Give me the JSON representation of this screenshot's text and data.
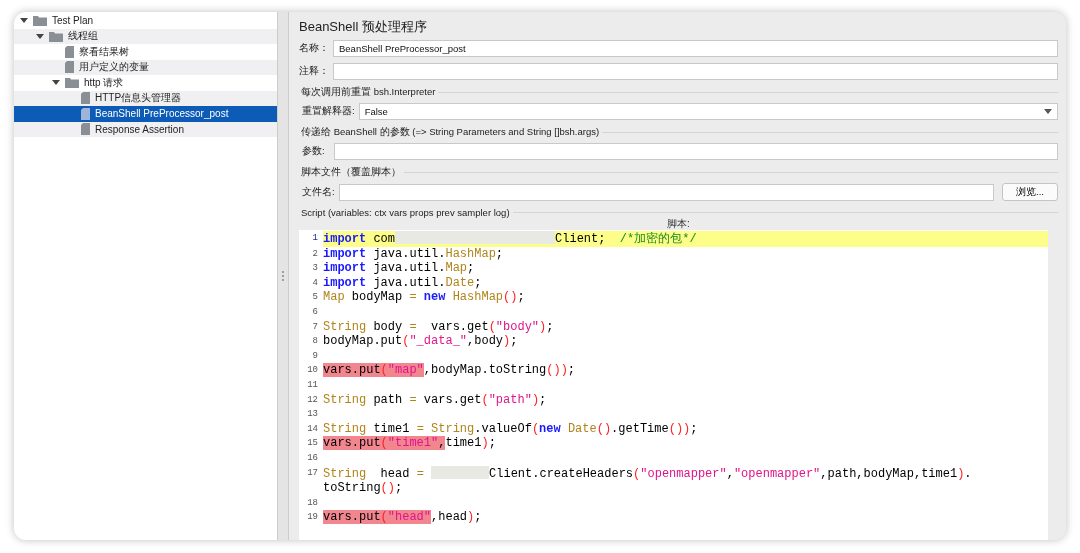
{
  "tree": [
    {
      "label": "Test Plan",
      "expanded": true,
      "selected": false,
      "children": [
        {
          "label": "线程组",
          "expanded": true,
          "selected": false,
          "children": [
            {
              "label": "察看结果树",
              "selected": false
            },
            {
              "label": "用户定义的变量",
              "selected": false
            },
            {
              "label": "http 请求",
              "expanded": true,
              "selected": false,
              "children": [
                {
                  "label": "HTTP信息头管理器",
                  "selected": false
                },
                {
                  "label": "BeanShell PreProcessor_post",
                  "selected": true
                },
                {
                  "label": "Response Assertion",
                  "selected": false
                }
              ]
            }
          ]
        }
      ]
    }
  ],
  "panel": {
    "title": "BeanShell 预处理程序",
    "name_field": {
      "label": "名称：",
      "value": "BeanShell PreProcessor_post"
    },
    "comment_field": {
      "label": "注释："
    },
    "reset_section": {
      "title": "每次调用前重置 bsh.Interpreter",
      "label": "重置解释器:",
      "value": "False"
    },
    "params_section": {
      "title": "传递给 BeanShell 的参数 (=> String Parameters and String []bsh.args)",
      "label": "参数:"
    },
    "file_section": {
      "title": "脚本文件（覆盖脚本）",
      "label": "文件名:",
      "button": "浏览..."
    },
    "script_section": {
      "title": "Script (variables: ctx vars props prev sampler log)",
      "editor_label": "脚本:",
      "lines": [
        {
          "number": "1",
          "current": true,
          "tokens": [
            {
              "kind": "keyword",
              "text": "import"
            },
            {
              "kind": "plain",
              "text": " com"
            },
            {
              "kind": "redacted_long"
            },
            {
              "kind": "plain",
              "text": "Client;  "
            },
            {
              "kind": "comment",
              "text": "/*加密的包*/"
            }
          ]
        },
        {
          "number": "2",
          "current": false,
          "tokens": [
            {
              "kind": "keyword",
              "text": "import"
            },
            {
              "kind": "plain",
              "text": " java.util."
            },
            {
              "kind": "type",
              "text": "HashMap"
            },
            {
              "kind": "plain",
              "text": ";"
            }
          ]
        },
        {
          "number": "3",
          "current": false,
          "tokens": [
            {
              "kind": "keyword",
              "text": "import"
            },
            {
              "kind": "plain",
              "text": " java.util."
            },
            {
              "kind": "type",
              "text": "Map"
            },
            {
              "kind": "plain",
              "text": ";"
            }
          ]
        },
        {
          "number": "4",
          "current": false,
          "tokens": [
            {
              "kind": "keyword",
              "text": "import"
            },
            {
              "kind": "plain",
              "text": " java.util."
            },
            {
              "kind": "type",
              "text": "Date"
            },
            {
              "kind": "plain",
              "text": ";"
            }
          ]
        },
        {
          "number": "5",
          "current": false,
          "tokens": [
            {
              "kind": "type",
              "text": "Map"
            },
            {
              "kind": "plain",
              "text": " bodyMap "
            },
            {
              "kind": "operator",
              "text": "="
            },
            {
              "kind": "keyword",
              "text": " new"
            },
            {
              "kind": "type",
              "text": " HashMap"
            },
            {
              "kind": "paren",
              "text": "()"
            },
            {
              "kind": "plain",
              "text": ";"
            }
          ]
        },
        {
          "number": "6",
          "current": false
        },
        {
          "number": "7",
          "current": false,
          "tokens": [
            {
              "kind": "type",
              "text": "String"
            },
            {
              "kind": "plain",
              "text": " body "
            },
            {
              "kind": "operator",
              "text": "="
            },
            {
              "kind": "plain",
              "text": "  vars.get"
            },
            {
              "kind": "paren",
              "text": "("
            },
            {
              "kind": "string",
              "text": "\"body\""
            },
            {
              "kind": "paren",
              "text": ")"
            },
            {
              "kind": "plain",
              "text": ";"
            }
          ]
        },
        {
          "number": "8",
          "current": false,
          "tokens": [
            {
              "kind": "plain",
              "text": "bodyMap.put"
            },
            {
              "kind": "paren",
              "text": "("
            },
            {
              "kind": "string",
              "text": "\"_data_\""
            },
            {
              "kind": "plain",
              "text": ",body"
            },
            {
              "kind": "paren",
              "text": ")"
            },
            {
              "kind": "plain",
              "text": ";"
            }
          ]
        },
        {
          "number": "9",
          "current": false
        },
        {
          "number": "10",
          "current": false,
          "tokens": [
            {
              "kind": "plain",
              "text": "vars.put",
              "marked": true
            },
            {
              "kind": "paren",
              "text": "(",
              "marked": true
            },
            {
              "kind": "string",
              "text": "\"map\"",
              "marked": true
            },
            {
              "kind": "plain",
              "text": ",bodyMap.toString"
            },
            {
              "kind": "paren",
              "text": "())"
            },
            {
              "kind": "plain",
              "text": ";"
            }
          ]
        },
        {
          "number": "11",
          "current": false
        },
        {
          "number": "12",
          "current": false,
          "tokens": [
            {
              "kind": "type",
              "text": "String"
            },
            {
              "kind": "plain",
              "text": " path "
            },
            {
              "kind": "operator",
              "text": "="
            },
            {
              "kind": "plain",
              "text": " vars.get"
            },
            {
              "kind": "paren",
              "text": "("
            },
            {
              "kind": "string",
              "text": "\"path\""
            },
            {
              "kind": "paren",
              "text": ")"
            },
            {
              "kind": "plain",
              "text": ";"
            }
          ]
        },
        {
          "number": "13",
          "current": false
        },
        {
          "number": "14",
          "current": false,
          "tokens": [
            {
              "kind": "type",
              "text": "String"
            },
            {
              "kind": "plain",
              "text": " time1 "
            },
            {
              "kind": "operator",
              "text": "="
            },
            {
              "kind": "type",
              "text": " String"
            },
            {
              "kind": "plain",
              "text": ".valueOf"
            },
            {
              "kind": "paren",
              "text": "("
            },
            {
              "kind": "keyword",
              "text": "new"
            },
            {
              "kind": "type",
              "text": " Date"
            },
            {
              "kind": "paren",
              "text": "()"
            },
            {
              "kind": "plain",
              "text": ".getTime"
            },
            {
              "kind": "paren",
              "text": "())"
            },
            {
              "kind": "plain",
              "text": ";"
            }
          ]
        },
        {
          "number": "15",
          "current": false,
          "tokens": [
            {
              "kind": "plain",
              "text": "vars.put",
              "marked": true
            },
            {
              "kind": "paren",
              "text": "(",
              "marked": true
            },
            {
              "kind": "string",
              "text": "\"time1\"",
              "marked": true
            },
            {
              "kind": "plain",
              "text": ",",
              "marked": true
            },
            {
              "kind": "plain",
              "text": "time1"
            },
            {
              "kind": "paren",
              "text": ")"
            },
            {
              "kind": "plain",
              "text": ";"
            }
          ]
        },
        {
          "number": "16",
          "current": false
        },
        {
          "number": "17",
          "current": false,
          "tokens": [
            {
              "kind": "type",
              "text": "String"
            },
            {
              "kind": "plain",
              "text": "  head "
            },
            {
              "kind": "operator",
              "text": "= "
            },
            {
              "kind": "redacted_short"
            },
            {
              "kind": "plain",
              "text": "Client.createHeaders"
            },
            {
              "kind": "paren",
              "text": "("
            },
            {
              "kind": "string",
              "text": "\"openmapper\""
            },
            {
              "kind": "plain",
              "text": ","
            },
            {
              "kind": "string",
              "text": "\"openmapper\""
            },
            {
              "kind": "plain",
              "text": ",path,bodyMap,time1"
            },
            {
              "kind": "paren",
              "text": ")"
            },
            {
              "kind": "plain",
              "text": "."
            },
            {
              "kind": "break"
            },
            {
              "kind": "plain",
              "text": "toString"
            },
            {
              "kind": "paren",
              "text": "()"
            },
            {
              "kind": "plain",
              "text": ";"
            }
          ]
        },
        {
          "number": "18",
          "current": false
        },
        {
          "number": "19",
          "current": false,
          "tokens": [
            {
              "kind": "plain",
              "text": "vars.put",
              "marked": true
            },
            {
              "kind": "paren",
              "text": "(",
              "marked": true
            },
            {
              "kind": "string",
              "text": "\"head\"",
              "marked": true
            },
            {
              "kind": "plain",
              "text": ",head"
            },
            {
              "kind": "paren",
              "text": ")"
            },
            {
              "kind": "plain",
              "text": ";"
            }
          ]
        }
      ]
    }
  }
}
